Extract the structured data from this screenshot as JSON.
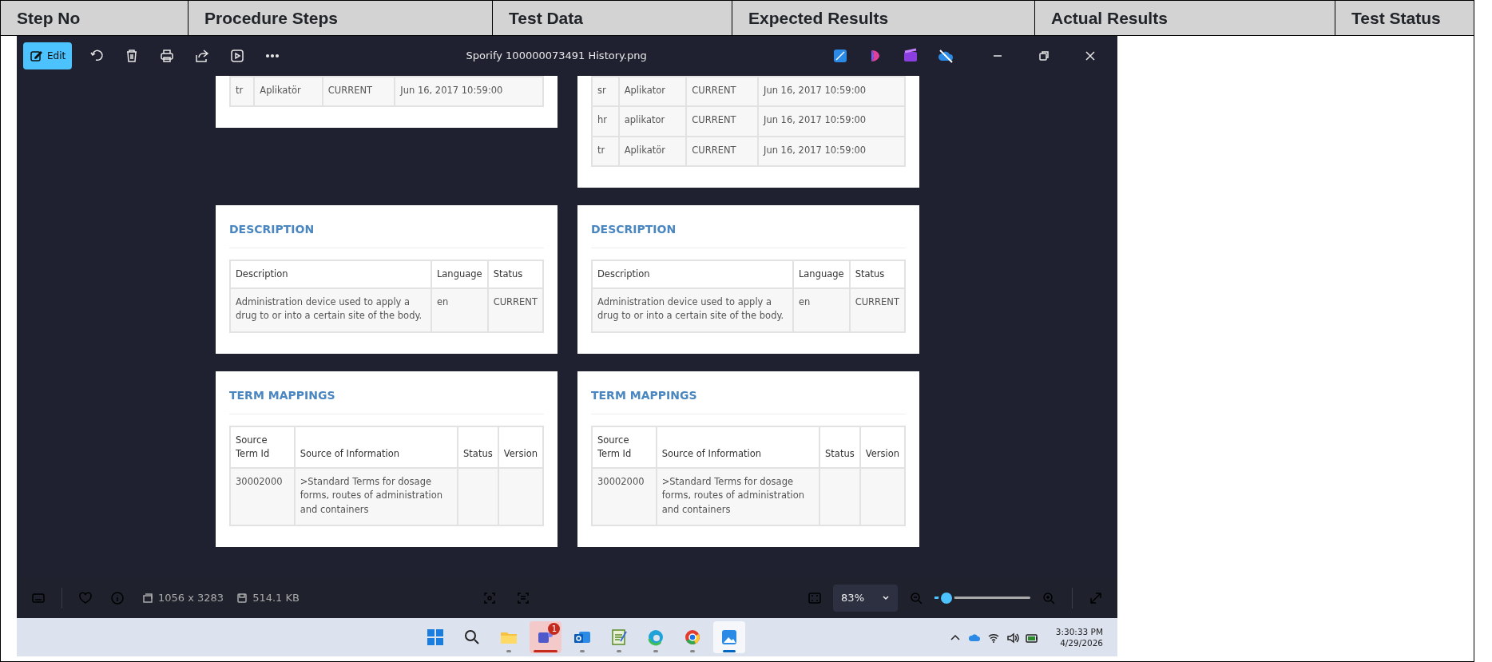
{
  "document_table": {
    "columns": [
      "Step No",
      "Procedure Steps",
      "Test Data",
      "Expected Results",
      "Actual Results",
      "Test Status"
    ]
  },
  "photo_viewer": {
    "title": "Sporify 100000073491 History.png",
    "toolbar": [
      {
        "kind": "edit",
        "label": "Edit"
      },
      {
        "kind": "rotate"
      },
      {
        "kind": "delete"
      },
      {
        "kind": "print"
      },
      {
        "kind": "share"
      },
      {
        "kind": "slideshow"
      },
      {
        "kind": "more"
      }
    ],
    "app_icons": [
      {
        "kind": "designer"
      },
      {
        "kind": "copilot"
      },
      {
        "kind": "clipchamp"
      },
      {
        "kind": "cloud"
      }
    ],
    "card_rows": [
      [
        {
          "table": {
            "rows": [
              [
                "tr",
                "Aplikatör",
                "CURRENT",
                "Jun 16, 2017 10:59:00"
              ]
            ]
          }
        },
        {
          "table": {
            "rows": [
              [
                "sr",
                "Aplikator",
                "CURRENT",
                "Jun 16, 2017 10:59:00"
              ],
              [
                "hr",
                "aplikator",
                "CURRENT",
                "Jun 16, 2017 10:59:00"
              ],
              [
                "tr",
                "Aplikatör",
                "CURRENT",
                "Jun 16, 2017 10:59:00"
              ]
            ]
          }
        }
      ],
      [
        {
          "heading": "DESCRIPTION",
          "table": {
            "columns": [
              "Description",
              "Language",
              "Status"
            ],
            "rows": [
              [
                "Administration device used to apply a drug to or into a certain site of the body.",
                "en",
                "CURRENT"
              ]
            ]
          }
        },
        {
          "heading": "DESCRIPTION",
          "table": {
            "columns": [
              "Description",
              "Language",
              "Status"
            ],
            "rows": [
              [
                "Administration device used to apply a drug to or into a certain site of the body.",
                "en",
                "CURRENT"
              ]
            ]
          }
        }
      ],
      [
        {
          "heading": "TERM MAPPINGS",
          "table": {
            "columns": [
              "Source Term Id",
              "Source of Information",
              "Status",
              "Version"
            ],
            "rows": [
              [
                "30002000",
                ">Standard Terms for dosage forms, routes of administration and containers",
                "",
                ""
              ]
            ]
          }
        },
        {
          "heading": "TERM MAPPINGS",
          "table": {
            "columns": [
              "Source Term Id",
              "Source of Information",
              "Status",
              "Version"
            ],
            "rows": [
              [
                "30002000",
                ">Standard Terms for dosage forms, routes of administration and containers",
                "",
                ""
              ]
            ]
          }
        }
      ]
    ],
    "status_bar": {
      "dimensions": "1056 x 3283",
      "file_size": "514.1 KB",
      "zoom": "83%",
      "zoom_slider": {
        "level": 0.1
      }
    }
  },
  "taskbar": {
    "apps": [
      {
        "kind": "start",
        "running": false,
        "selected": false
      },
      {
        "kind": "search",
        "running": false,
        "selected": false
      },
      {
        "kind": "folder",
        "running": true,
        "selected": false
      },
      {
        "kind": "teams",
        "running": true,
        "selected": false,
        "badge": "1",
        "attention": true
      },
      {
        "kind": "mail",
        "running": true,
        "selected": false
      },
      {
        "kind": "notepad",
        "running": true,
        "selected": false
      },
      {
        "kind": "edge",
        "running": true,
        "selected": false
      },
      {
        "kind": "chrome",
        "running": true,
        "selected": false
      },
      {
        "kind": "photos",
        "running": true,
        "selected": true
      }
    ],
    "clock": {
      "time": "3:30:33 PM",
      "date": "4/29/2026"
    }
  }
}
